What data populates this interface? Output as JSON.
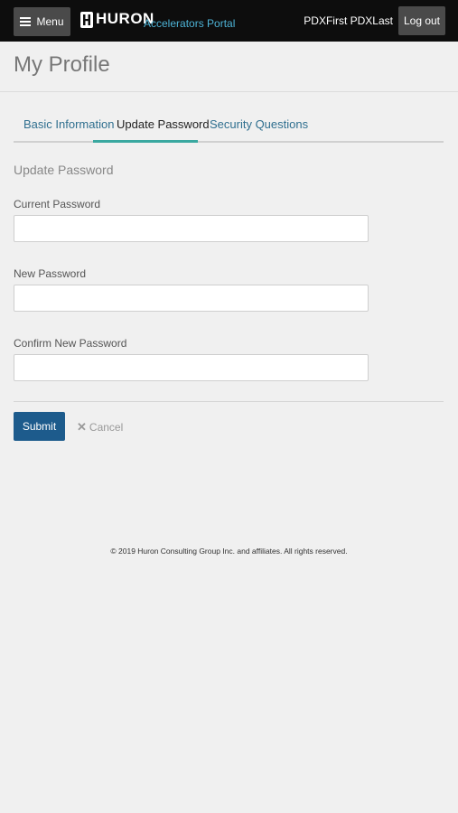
{
  "topbar": {
    "menu_label": "Menu",
    "brand": "HURON",
    "portal": "Accelerators Portal",
    "user": "PDXFirst PDXLast",
    "logout_label": "Log out"
  },
  "page": {
    "title": "My Profile"
  },
  "tabs": [
    {
      "label": "Basic Information",
      "active": false
    },
    {
      "label": "Update Password",
      "active": true
    },
    {
      "label": "Security Questions",
      "active": false
    }
  ],
  "form": {
    "section_title": "Update Password",
    "fields": [
      {
        "label": "Current Password",
        "value": ""
      },
      {
        "label": "New Password",
        "value": ""
      },
      {
        "label": "Confirm New Password",
        "value": ""
      }
    ],
    "submit_label": "Submit",
    "cancel_label": "Cancel"
  },
  "footer": {
    "copyright": "© 2019 Huron Consulting Group Inc. and affiliates. All rights reserved."
  },
  "colors": {
    "topbar": "#0d0d0d",
    "accent": "#3aa8a0",
    "primary_button": "#1d5b8c",
    "link": "#2f6f8f"
  }
}
